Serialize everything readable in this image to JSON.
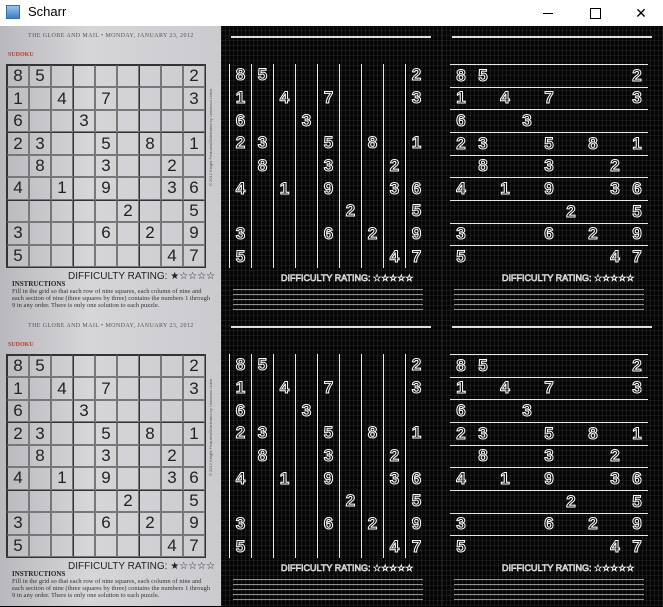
{
  "window": {
    "title": "Scharr",
    "icon": "opencv-window-icon"
  },
  "controls": {
    "minimize": "minimize-icon",
    "maximize": "maximize-icon",
    "close": "close-icon"
  },
  "newspaper": {
    "header": "THE GLOBE AND MAIL  •  MONDAY, JANUARY 23, 2012",
    "section": "SUDOKU",
    "difficulty": "DIFFICULTY RATING: ★☆☆☆☆",
    "instructions_title": "INSTRUCTIONS",
    "instructions": "Fill in the grid so that each row of nine squares, each column of nine and each section of nine (three squares by three) contains the numbers 1 through 9 in any order. There is only one solution to each puzzle.",
    "copyright": "© 2012 Knight Features/Distributed by Universal Uclick"
  },
  "sudoku": [
    [
      "8",
      "5",
      "",
      "",
      "",
      "",
      "",
      "",
      "2"
    ],
    [
      "1",
      "",
      "4",
      "",
      "7",
      "",
      "",
      "",
      "3"
    ],
    [
      "6",
      "",
      "",
      "3",
      "",
      "",
      "",
      "",
      ""
    ],
    [
      "2",
      "3",
      "",
      "",
      "5",
      "",
      "8",
      "",
      "1"
    ],
    [
      "",
      "8",
      "",
      "",
      "3",
      "",
      "",
      "2",
      ""
    ],
    [
      "4",
      "",
      "1",
      "",
      "9",
      "",
      "",
      "3",
      "6"
    ],
    [
      "",
      "",
      "",
      "",
      "",
      "2",
      "",
      "",
      "5"
    ],
    [
      "3",
      "",
      "",
      "",
      "6",
      "",
      "2",
      "",
      "9"
    ],
    [
      "5",
      "",
      "",
      "",
      "",
      "",
      "",
      "4",
      "7"
    ]
  ],
  "panels": [
    {
      "row": "top",
      "column": "left",
      "kind": "original"
    },
    {
      "row": "top",
      "column": "middle",
      "kind": "scharr-x"
    },
    {
      "row": "top",
      "column": "right",
      "kind": "scharr-y"
    },
    {
      "row": "bottom",
      "column": "left",
      "kind": "original"
    },
    {
      "row": "bottom",
      "column": "middle",
      "kind": "scharr-x"
    },
    {
      "row": "bottom",
      "column": "right",
      "kind": "scharr-y"
    }
  ]
}
